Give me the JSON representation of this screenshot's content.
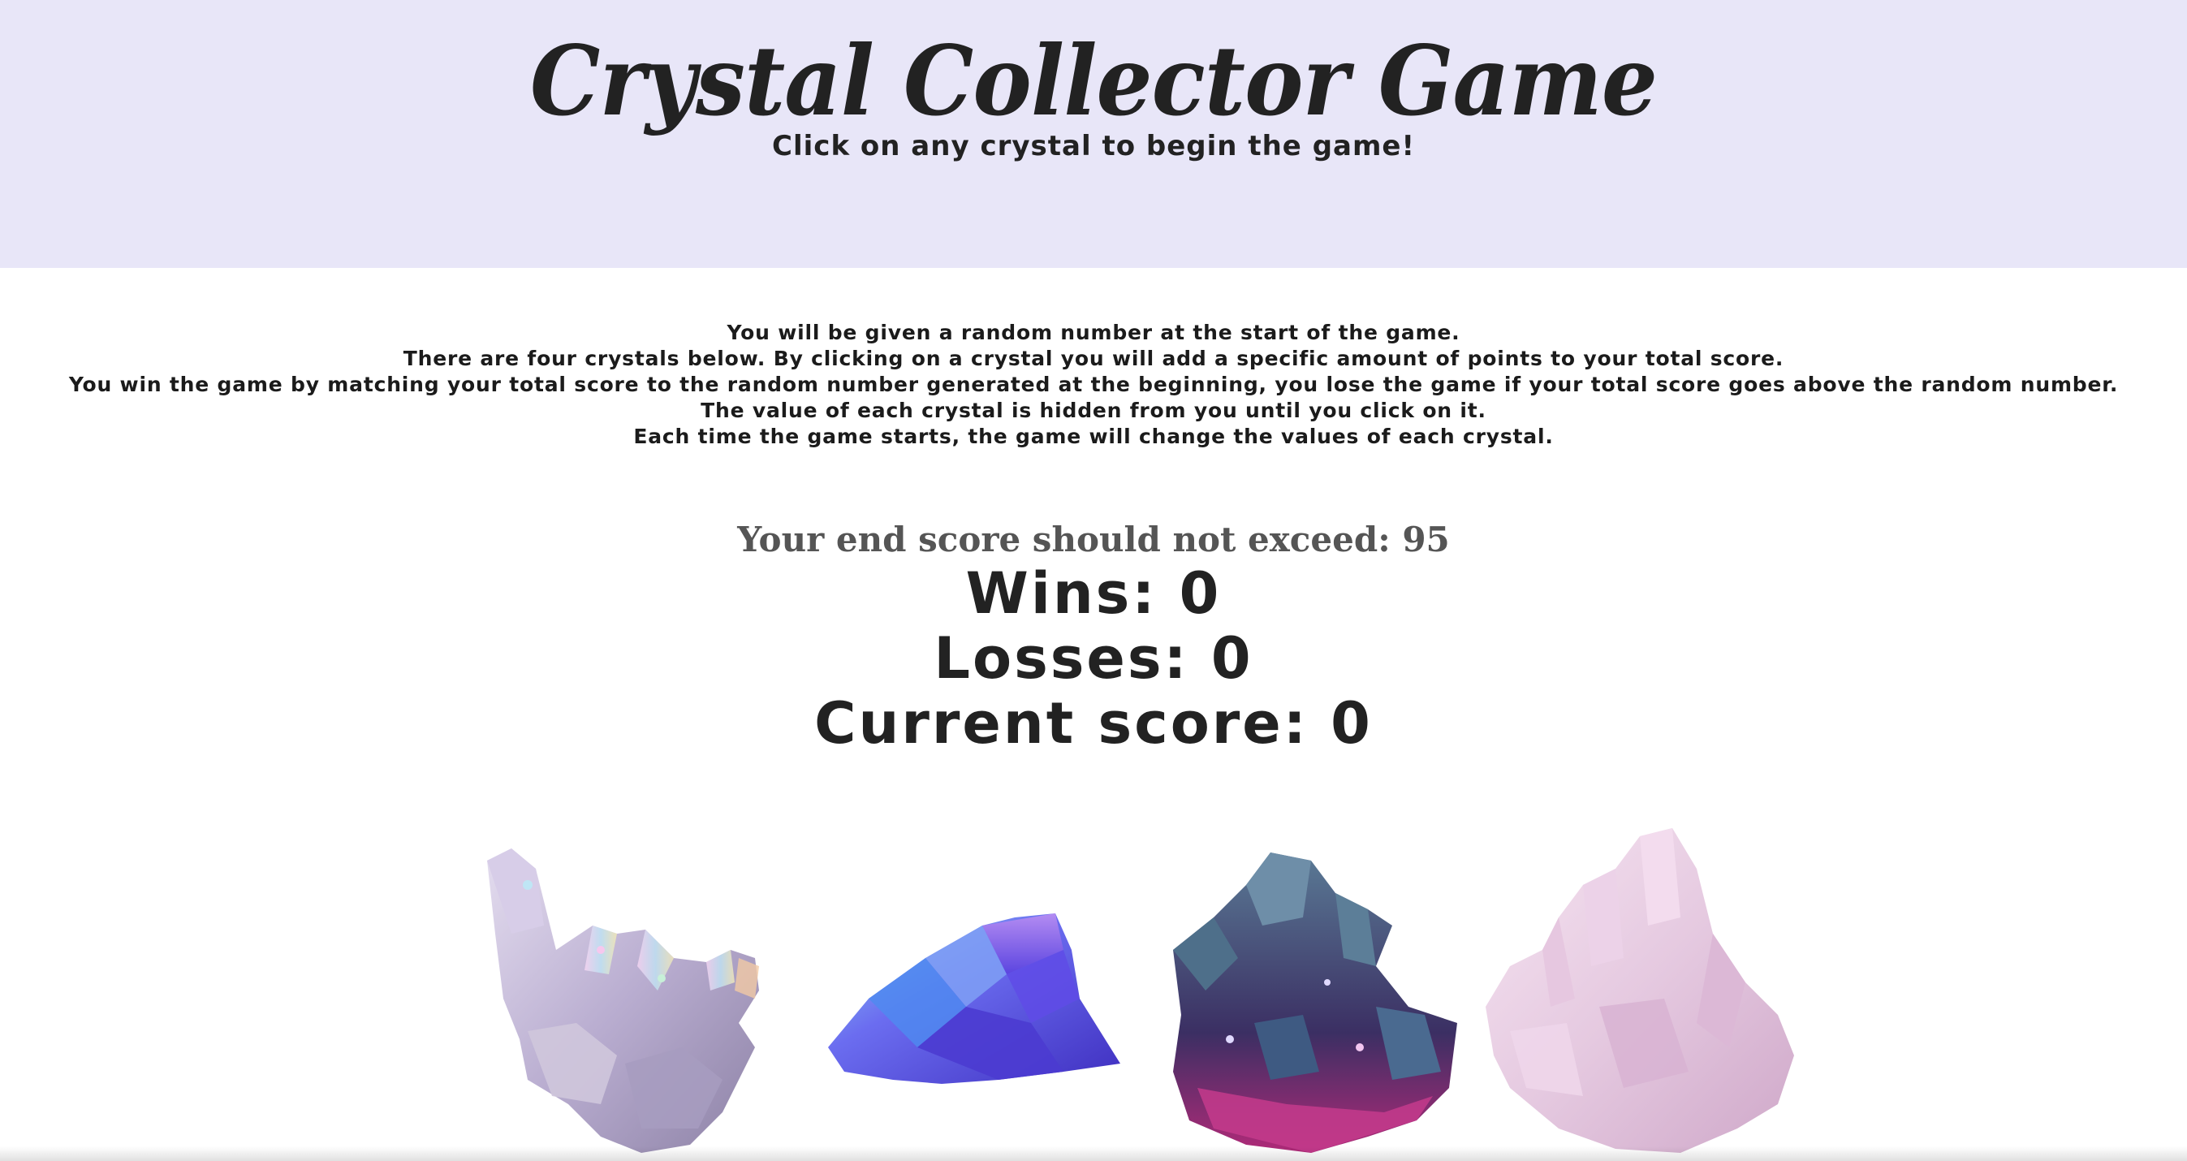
{
  "header": {
    "title": "Crystal Collector Game",
    "subtitle": "Click on any crystal to begin the game!"
  },
  "instructions": [
    "You will be given a random number at the start of the game.",
    "There are four crystals below. By clicking on a crystal you will add a specific amount of points to your total score.",
    "You win the game by matching your total score to the random number generated at the beginning, you lose the game if your total score goes above the random number.",
    "The value of each crystal is hidden from you until you click on it.",
    "Each time the game starts, the game will change the values of each crystal."
  ],
  "game": {
    "target_label": "Your end score should not exceed: 95",
    "wins_label": "Wins: 0",
    "losses_label": "Losses: 0",
    "score_label": "Current score: 0"
  },
  "crystals": [
    {
      "icon": "aura-quartz-crystal-icon",
      "color": "#c9c0dc"
    },
    {
      "icon": "blue-crystal-icon",
      "color": "#5a5ee8"
    },
    {
      "icon": "amethyst-geode-crystal-icon",
      "color": "#3d5a7a"
    },
    {
      "icon": "rose-quartz-crystal-icon",
      "color": "#e8cde2"
    }
  ],
  "colors": {
    "header_background": "#e8e6f8",
    "text": "#222222",
    "target_text": "#555555"
  }
}
